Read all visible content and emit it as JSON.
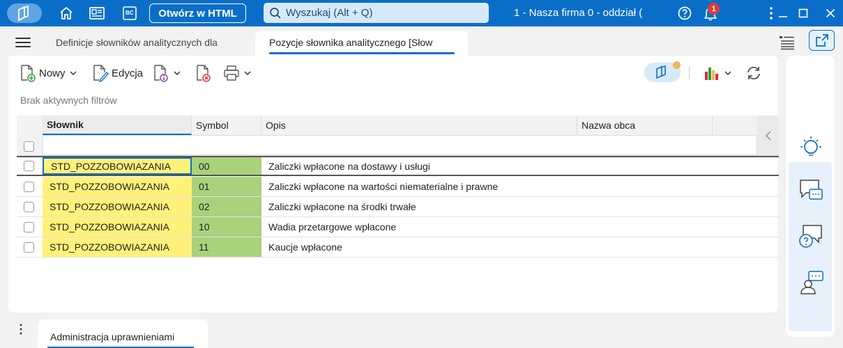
{
  "titlebar": {
    "html_button": "Otwórz w HTML",
    "search_placeholder": "Wyszukaj (Alt + Q)",
    "company": "1 - Nasza firma 0 - oddział (",
    "notifications_count": "1",
    "bc_label": "BC"
  },
  "tabs": {
    "tab1": "Definicje słowników analitycznych dla",
    "tab2": "Pozycje słownika analitycznego [Słow"
  },
  "toolbar": {
    "new_label": "Nowy",
    "edit_label": "Edycja"
  },
  "filters_text": "Brak aktywnych filtrów",
  "grid": {
    "columns": [
      "Słownik",
      "Symbol",
      "Opis",
      "Nazwa obca"
    ],
    "rows": [
      {
        "slownik": "STD_POZZOBOWIAZANIA",
        "symbol": "00",
        "opis": "Zaliczki wpłacone na dostawy i usługi"
      },
      {
        "slownik": "STD_POZZOBOWIAZANIA",
        "symbol": "01",
        "opis": "Zaliczki wpłacone na wartości niematerialne i prawne"
      },
      {
        "slownik": "STD_POZZOBOWIAZANIA",
        "symbol": "02",
        "opis": "Zaliczki wpłacone na środki trwałe"
      },
      {
        "slownik": "STD_POZZOBOWIAZANIA",
        "symbol": "10",
        "opis": "Wadia przetargowe wpłacone"
      },
      {
        "slownik": "STD_POZZOBOWIAZANIA",
        "symbol": "11",
        "opis": "Kaucje wpłacone"
      }
    ]
  },
  "bottom_tab": "Administracja uprawnieniami",
  "colors": {
    "accent": "#0a6ec8",
    "slownik_cell": "#fff17a",
    "symbol_cell": "#a9d27b",
    "notification": "#e53935"
  }
}
